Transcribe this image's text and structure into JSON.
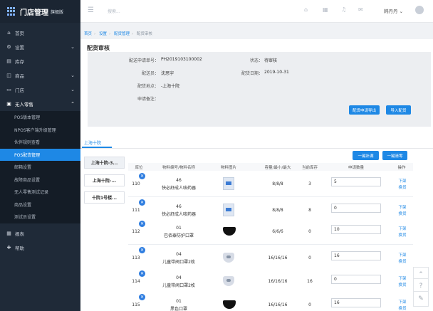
{
  "brand": {
    "title": "门店管理",
    "edition": "旗舰版"
  },
  "sidebar": {
    "items": [
      {
        "label": "首页",
        "icon": "home-icon",
        "glyph": "⌂"
      },
      {
        "label": "设置",
        "icon": "gear-icon",
        "glyph": "⚙"
      },
      {
        "label": "库存",
        "icon": "box-icon",
        "glyph": "▤"
      },
      {
        "label": "商品",
        "icon": "goods-icon",
        "glyph": "◫"
      },
      {
        "label": "门店",
        "icon": "store-icon",
        "glyph": "▭"
      },
      {
        "label": "无人零售",
        "icon": "retail-icon",
        "glyph": "▣"
      }
    ],
    "sub_items": [
      "POS版本管理",
      "NPOS客户端升级管理",
      "伙伴规则查看",
      "POS配货管理",
      "邮箱设置",
      "故障商品设置",
      "无人零售测试记录",
      "商品设置",
      "测试员设置"
    ],
    "bottom_items": [
      {
        "label": "报表",
        "icon": "report-icon",
        "glyph": "▦"
      },
      {
        "label": "帮助",
        "icon": "help-icon",
        "glyph": "✚"
      }
    ]
  },
  "topbar": {
    "search_placeholder": "搜索...",
    "user": "韩丹丹"
  },
  "breadcrumb": [
    "首页",
    "设置",
    "配货管理",
    "配货审核"
  ],
  "page": {
    "title": "配货审核"
  },
  "info": {
    "order_no_label": "配送申请单号：",
    "order_no": "PH2019103100002",
    "status_label": "状态：",
    "status": "待审核",
    "applicant_label": "配送员：",
    "applicant": "沈思宇",
    "date_label": "配货日期：",
    "date": "2019-10-31",
    "location_label": "配货地点：",
    "location": "-上海十院",
    "remark_label": "申请备注：",
    "export_btn": "配货申请导出",
    "import_btn": "导入配货"
  },
  "tab": "上海十院",
  "stores": [
    "上海十院-3...",
    "上海十院-...",
    "十院1号楼..."
  ],
  "buttons": {
    "fill_all": "一键补满",
    "clear_all": "一键清零"
  },
  "table": {
    "headers": [
      "库位",
      "物料编号/物料名称",
      "物料图片",
      "容量/最小/最大",
      "当前库存",
      "申请数量",
      "操作"
    ],
    "rows": [
      {
        "slot": "110",
        "code": "46",
        "name": "快必舒成人咳药器",
        "image": "medicine-box",
        "cap": "8/8/8",
        "stock": "3",
        "qty": "5",
        "op1": "下架",
        "op2": "换货"
      },
      {
        "slot": "111",
        "code": "46",
        "name": "快必舒成人咳药器",
        "image": "medicine-box",
        "cap": "8/8/8",
        "stock": "8",
        "qty": "0",
        "op1": "下架",
        "op2": "换货"
      },
      {
        "slot": "112",
        "code": "01",
        "name": "巴佰泰防护口罩",
        "image": "black-mask",
        "cap": "6/6/6",
        "stock": "0",
        "qty": "10",
        "op1": "下架",
        "op2": "换货"
      },
      {
        "slot": "113",
        "code": "04",
        "name": "儿童带阀口罩2枚",
        "image": "kids-mask",
        "cap": "16/16/16",
        "stock": "0",
        "qty": "16",
        "op1": "下架",
        "op2": "换货"
      },
      {
        "slot": "114",
        "code": "04",
        "name": "儿童带阀口罩2枚",
        "image": "kids-mask",
        "cap": "16/16/16",
        "stock": "16",
        "qty": "0",
        "op1": "下架",
        "op2": "换货"
      },
      {
        "slot": "115",
        "code": "01",
        "name": "黑色口罩",
        "image": "black-mask",
        "cap": "16/16/16",
        "stock": "0",
        "qty": "16",
        "op1": "下架",
        "op2": "换货"
      }
    ]
  },
  "colors": {
    "sidebar": "#1f2a38",
    "accent": "#1e88e5",
    "active_nav": "#1e88e5"
  }
}
